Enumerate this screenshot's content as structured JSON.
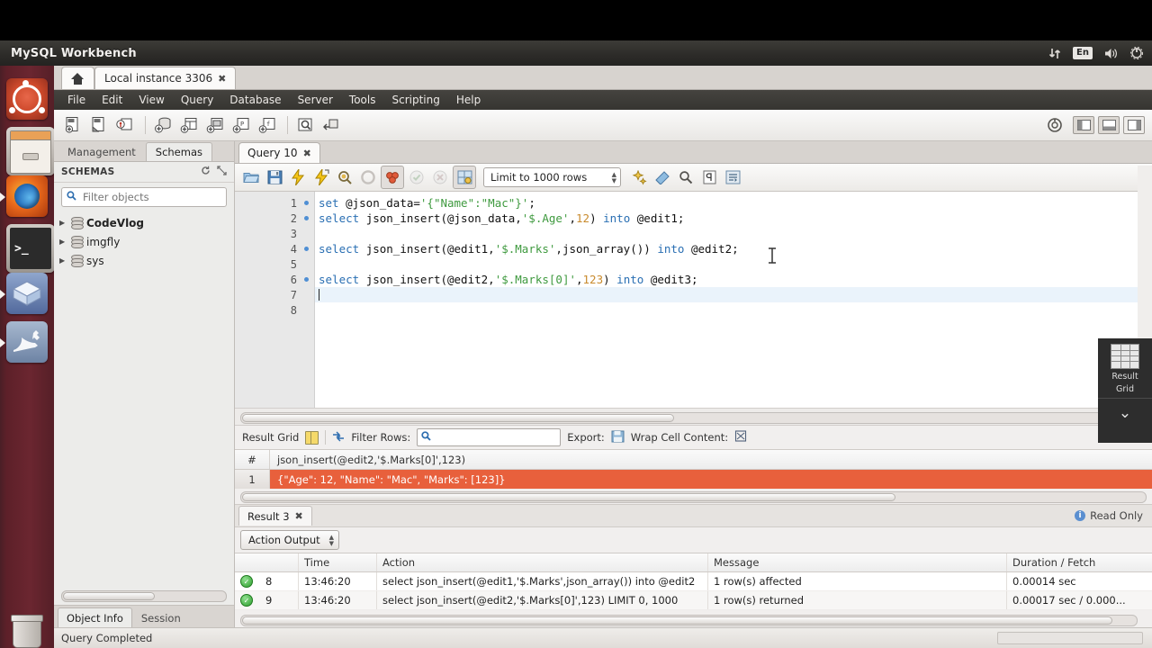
{
  "desktop": {
    "panel_title": "MySQL Workbench",
    "tray": {
      "network_icon": "network-updown-icon",
      "keyboard_layout": "En",
      "volume_icon": "volume-icon",
      "power_icon": "power-gear-icon"
    },
    "launcher_items": [
      {
        "name": "ubuntu-dash",
        "label": "Ubuntu"
      },
      {
        "name": "files",
        "label": "Files"
      },
      {
        "name": "firefox",
        "label": "Firefox"
      },
      {
        "name": "terminal",
        "label": "Terminal"
      },
      {
        "name": "virtualbox",
        "label": "VirtualBox"
      },
      {
        "name": "mysql-workbench",
        "label": "MySQL Workbench"
      },
      {
        "name": "trash",
        "label": "Trash"
      }
    ]
  },
  "workbench": {
    "home_tab": "",
    "instance_tab": "Local instance 3306",
    "close_glyph": "✖",
    "menu": [
      "File",
      "Edit",
      "View",
      "Query",
      "Database",
      "Server",
      "Tools",
      "Scripting",
      "Help"
    ],
    "main_toolbar_icons": [
      "new-sql-tab-icon",
      "open-sql-script-icon",
      "open-connection-icon",
      "new-schema-icon",
      "new-table-icon",
      "new-view-icon",
      "new-procedure-icon",
      "new-function-icon",
      "search-data-icon",
      "reconnect-icon"
    ],
    "panel_buttons": [
      "toggle-sidebar-icon",
      "toggle-output-icon",
      "toggle-secondary-sidebar-icon"
    ],
    "admin_icon": "server-status-icon"
  },
  "sidebar": {
    "tabs": [
      {
        "label": "Management",
        "active": false
      },
      {
        "label": "Schemas",
        "active": true
      }
    ],
    "section_title": "SCHEMAS",
    "section_actions": [
      "refresh-icon",
      "expand-icon"
    ],
    "filter_placeholder": "Filter objects",
    "filter_value": "",
    "schemas": [
      {
        "name": "CodeVlog",
        "bold": true
      },
      {
        "name": "imgfly",
        "bold": false
      },
      {
        "name": "sys",
        "bold": false
      }
    ],
    "bottom_tabs": [
      {
        "label": "Object Info",
        "active": true
      },
      {
        "label": "Session",
        "active": false
      }
    ]
  },
  "query": {
    "tab_label": "Query 10",
    "toolbar_icons": [
      "open-script-icon",
      "save-script-icon",
      "execute-icon",
      "execute-current-statement-icon",
      "explain-icon",
      "stop-icon",
      "toggle-query-stop-icon",
      "commit-icon",
      "rollback-icon",
      "autocommit-icon"
    ],
    "limit_label": "Limit to 1000 rows",
    "right_toolbar_icons": [
      "beautify-icon",
      "find-icon",
      "toggle-invisible-icon",
      "wrap-lines-icon"
    ],
    "line_numbers": [
      "1",
      "2",
      "3",
      "4",
      "5",
      "6",
      "7",
      "8"
    ],
    "breakpoint_lines": [
      1,
      2,
      4,
      6
    ],
    "current_line": 7,
    "code_lines": [
      {
        "n": 1,
        "tokens": [
          {
            "t": "set ",
            "c": "kw"
          },
          {
            "t": "@json_data=",
            "c": "var"
          },
          {
            "t": "'{\"Name\":\"Mac\"}'",
            "c": "str"
          },
          {
            "t": ";",
            "c": "var"
          }
        ]
      },
      {
        "n": 2,
        "tokens": [
          {
            "t": "select ",
            "c": "kw"
          },
          {
            "t": "json_insert(@json_data,",
            "c": "var"
          },
          {
            "t": "'$.Age'",
            "c": "str"
          },
          {
            "t": ",",
            "c": "var"
          },
          {
            "t": "12",
            "c": "num"
          },
          {
            "t": ") ",
            "c": "var"
          },
          {
            "t": "into ",
            "c": "kw"
          },
          {
            "t": "@edit1;",
            "c": "var"
          }
        ]
      },
      {
        "n": 3,
        "tokens": []
      },
      {
        "n": 4,
        "tokens": [
          {
            "t": "select ",
            "c": "kw"
          },
          {
            "t": "json_insert(@edit1,",
            "c": "var"
          },
          {
            "t": "'$.Marks'",
            "c": "str"
          },
          {
            "t": ",json_array()) ",
            "c": "var"
          },
          {
            "t": "into ",
            "c": "kw"
          },
          {
            "t": "@edit2;",
            "c": "var"
          }
        ]
      },
      {
        "n": 5,
        "tokens": []
      },
      {
        "n": 6,
        "tokens": [
          {
            "t": "select ",
            "c": "kw"
          },
          {
            "t": "json_insert(@edit2,",
            "c": "var"
          },
          {
            "t": "'$.Marks[0]'",
            "c": "str"
          },
          {
            "t": ",",
            "c": "var"
          },
          {
            "t": "123",
            "c": "num"
          },
          {
            "t": ") ",
            "c": "var"
          },
          {
            "t": "into ",
            "c": "kw"
          },
          {
            "t": "@edit3;",
            "c": "var"
          }
        ]
      },
      {
        "n": 7,
        "tokens": []
      },
      {
        "n": 8,
        "tokens": []
      }
    ]
  },
  "results": {
    "grid_label": "Result Grid",
    "filter_rows_label": "Filter Rows:",
    "filter_rows_value": "",
    "export_label": "Export:",
    "wrap_label": "Wrap Cell Content:",
    "columns": [
      "#",
      "json_insert(@edit2,'$.Marks[0]',123)"
    ],
    "rows": [
      {
        "num": "1",
        "value": "{\"Age\": 12, \"Name\": \"Mac\", \"Marks\": [123]}",
        "selected": true
      }
    ],
    "selection_color": "#e8603c",
    "result_tab": "Result 3",
    "read_only": "Read Only",
    "side_panel_label": "Result\nGrid",
    "side_panel_line1": "Result",
    "side_panel_line2": "Grid"
  },
  "action_output": {
    "selector_label": "Action Output",
    "columns": [
      "",
      "",
      "Time",
      "Action",
      "Message",
      "Duration / Fetch"
    ],
    "rows": [
      {
        "status": "ok",
        "no": "8",
        "time": "13:46:20",
        "action": "select json_insert(@edit1,'$.Marks',json_array()) into @edit2",
        "message": "1 row(s) affected",
        "duration": "0.00014 sec"
      },
      {
        "status": "ok",
        "no": "9",
        "time": "13:46:20",
        "action": "select json_insert(@edit2,'$.Marks[0]',123) LIMIT 0, 1000",
        "message": "1 row(s) returned",
        "duration": "0.00017 sec / 0.000..."
      }
    ]
  },
  "statusbar": {
    "text": "Query Completed"
  }
}
